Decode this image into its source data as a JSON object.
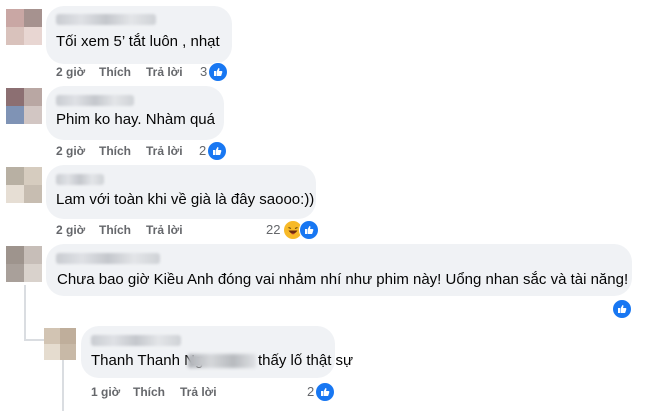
{
  "comments": [
    {
      "text": "Tối xem 5’ tắt luôn , nhạt",
      "time": "2 giờ",
      "like_label": "Thích",
      "reply_label": "Trả lời",
      "reaction_count": "3"
    },
    {
      "text": "Phim ko hay. Nhàm quá",
      "time": "2 giờ",
      "like_label": "Thích",
      "reply_label": "Trả lời",
      "reaction_count": "2"
    },
    {
      "text": "Lam với toàn khi về già là đây saooo:))",
      "time": "2 giờ",
      "like_label": "Thích",
      "reply_label": "Trả lời",
      "reaction_count": "22"
    },
    {
      "text": "Chưa bao giờ Kiều Anh đóng vai nhảm nhí như phim này! Uổng nhan sắc và tài năng!",
      "time": "",
      "like_label": "",
      "reply_label": "",
      "reaction_count": ""
    }
  ],
  "reply": {
    "text_start": "Thanh Thanh Ng",
    "text_end": "thấy lố thật sự",
    "time": "1 giờ",
    "like_label": "Thích",
    "reply_label": "Trả lời",
    "reaction_count": "2"
  },
  "colors": {
    "bubble": "#f0f2f5",
    "meta": "#65676b",
    "like_blue": "#1877f2",
    "haha_yellow": "#f7b928"
  },
  "icons": [
    "like-icon",
    "haha-icon"
  ]
}
